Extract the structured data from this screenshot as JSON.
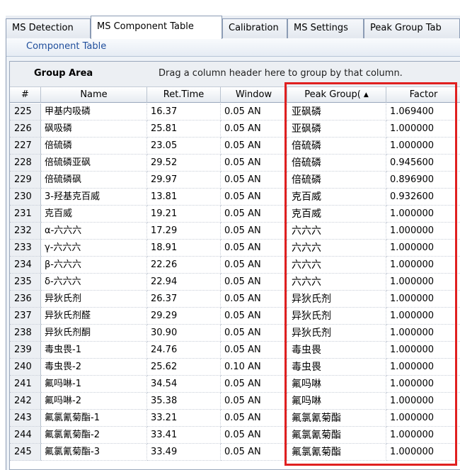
{
  "tabs": [
    "MS Detection",
    "MS Component Table",
    "Calibration",
    "MS Settings",
    "Peak Group Tab"
  ],
  "active_tab": 1,
  "subheader": "Component Table",
  "group_area": {
    "title": "Group Area",
    "hint": "Drag a column header here to group by that column."
  },
  "columns": {
    "num": "#",
    "name": "Name",
    "ret": "Ret.Time",
    "win": "Window",
    "pg": "Peak Group(",
    "fac": "Factor"
  },
  "sort_indicator": "▲",
  "highlight_color": "#e02020",
  "rows": [
    {
      "num": "225",
      "name": "甲基内吸磷",
      "ret": "16.37",
      "win": "0.05 AN",
      "pg": "亚砜磷",
      "fac": "1.069400"
    },
    {
      "num": "226",
      "name": "砜吸磷",
      "ret": "25.81",
      "win": "0.05 AN",
      "pg": "亚砜磷",
      "fac": "1.000000"
    },
    {
      "num": "227",
      "name": "倍硫磷",
      "ret": "23.05",
      "win": "0.05 AN",
      "pg": "倍硫磷",
      "fac": "1.000000"
    },
    {
      "num": "228",
      "name": "倍硫磷亚砜",
      "ret": "29.52",
      "win": "0.05 AN",
      "pg": "倍硫磷",
      "fac": "0.945600"
    },
    {
      "num": "229",
      "name": "倍硫磷砜",
      "ret": "29.97",
      "win": "0.05 AN",
      "pg": "倍硫磷",
      "fac": "0.896900"
    },
    {
      "num": "230",
      "name": "3-羟基克百威",
      "ret": "13.81",
      "win": "0.05 AN",
      "pg": "克百威",
      "fac": "0.932600"
    },
    {
      "num": "231",
      "name": "克百威",
      "ret": "19.21",
      "win": "0.05 AN",
      "pg": "克百威",
      "fac": "1.000000"
    },
    {
      "num": "232",
      "name": "α-六六六",
      "ret": "17.29",
      "win": "0.05 AN",
      "pg": "六六六",
      "fac": "1.000000"
    },
    {
      "num": "233",
      "name": "γ-六六六",
      "ret": "18.91",
      "win": "0.05 AN",
      "pg": "六六六",
      "fac": "1.000000"
    },
    {
      "num": "234",
      "name": "β-六六六",
      "ret": "22.26",
      "win": "0.05 AN",
      "pg": "六六六",
      "fac": "1.000000"
    },
    {
      "num": "235",
      "name": "δ-六六六",
      "ret": "22.94",
      "win": "0.05 AN",
      "pg": "六六六",
      "fac": "1.000000"
    },
    {
      "num": "236",
      "name": "异狄氏剂",
      "ret": "26.37",
      "win": "0.05 AN",
      "pg": "异狄氏剂",
      "fac": "1.000000"
    },
    {
      "num": "237",
      "name": "异狄氏剂醛",
      "ret": "29.29",
      "win": "0.05 AN",
      "pg": "异狄氏剂",
      "fac": "1.000000"
    },
    {
      "num": "238",
      "name": "异狄氏剂酮",
      "ret": "30.90",
      "win": "0.05 AN",
      "pg": "异狄氏剂",
      "fac": "1.000000"
    },
    {
      "num": "239",
      "name": "毒虫畏-1",
      "ret": "24.76",
      "win": "0.05 AN",
      "pg": "毒虫畏",
      "fac": "1.000000"
    },
    {
      "num": "240",
      "name": "毒虫畏-2",
      "ret": "25.62",
      "win": "0.10 AN",
      "pg": "毒虫畏",
      "fac": "1.000000"
    },
    {
      "num": "241",
      "name": "氟吗啉-1",
      "ret": "34.54",
      "win": "0.05 AN",
      "pg": "氟吗啉",
      "fac": "1.000000"
    },
    {
      "num": "242",
      "name": "氟吗啉-2",
      "ret": "35.38",
      "win": "0.05 AN",
      "pg": "氟吗啉",
      "fac": "1.000000"
    },
    {
      "num": "243",
      "name": "氟氯氰菊酯-1",
      "ret": "33.21",
      "win": "0.05 AN",
      "pg": "氟氯氰菊酯",
      "fac": "1.000000"
    },
    {
      "num": "244",
      "name": "氟氯氰菊酯-2",
      "ret": "33.41",
      "win": "0.05 AN",
      "pg": "氟氯氰菊酯",
      "fac": "1.000000"
    },
    {
      "num": "245",
      "name": "氟氯氰菊酯-3",
      "ret": "33.49",
      "win": "0.05 AN",
      "pg": "氟氯氰菊酯",
      "fac": "1.000000"
    }
  ]
}
